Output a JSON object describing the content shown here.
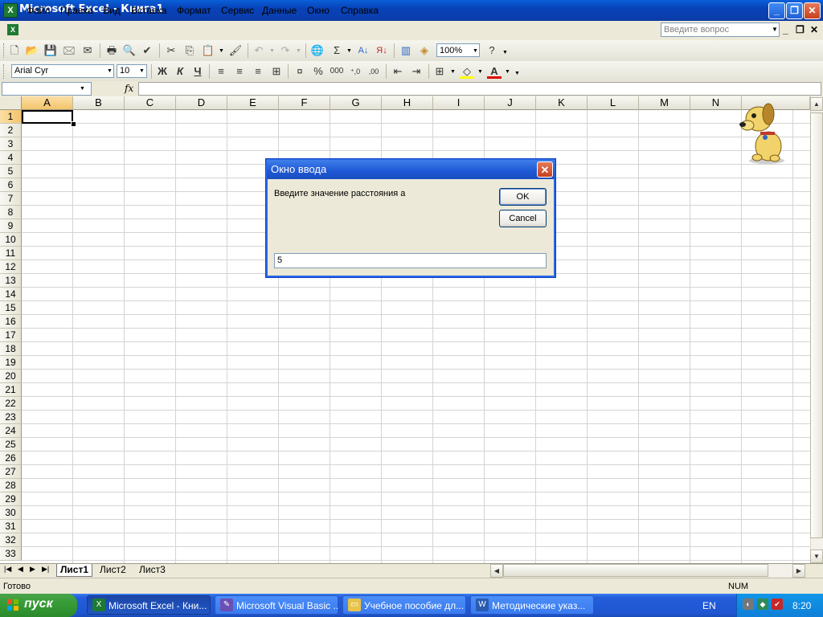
{
  "window": {
    "title": "Microsoft Excel - Книга1",
    "buttons": {
      "minimize": "_",
      "maximize": "❐",
      "close": "✕"
    }
  },
  "menu": {
    "items": [
      "Файл",
      "Правка",
      "Вид",
      "Вставка",
      "Формат",
      "Сервис",
      "Данные",
      "Окно",
      "Справка"
    ],
    "help_placeholder": "Введите вопрос"
  },
  "toolbar": {
    "zoom": "100%",
    "font_name": "Arial Cyr",
    "font_size": "10",
    "bold": "Ж",
    "italic": "К",
    "underline": "Ч"
  },
  "formula_bar": {
    "name_box": "",
    "fx": "fx",
    "content": ""
  },
  "sheet": {
    "columns": [
      "A",
      "B",
      "C",
      "D",
      "E",
      "F",
      "G",
      "H",
      "I",
      "J",
      "K",
      "L",
      "M",
      "N"
    ],
    "rows": [
      "1",
      "2",
      "3",
      "4",
      "5",
      "6",
      "7",
      "8",
      "9",
      "10",
      "11",
      "12",
      "13",
      "14",
      "15",
      "16",
      "17",
      "18",
      "19",
      "20",
      "21",
      "22",
      "23",
      "24",
      "25",
      "26",
      "27",
      "28",
      "29",
      "30",
      "31",
      "32",
      "33"
    ],
    "selected_column": "A",
    "selected_row": "1"
  },
  "tabs": {
    "sheets": [
      "Лист1",
      "Лист2",
      "Лист3"
    ],
    "active": "Лист1"
  },
  "status": {
    "text": "Готово",
    "num": "NUM"
  },
  "dialog": {
    "title": "Окно ввода",
    "prompt": "Введите значение расстояния а",
    "ok": "OK",
    "cancel": "Cancel",
    "input_value": "5"
  },
  "taskbar": {
    "start": "пуск",
    "tasks": [
      {
        "label": "Microsoft Excel - Кни...",
        "active": true
      },
      {
        "label": "Microsoft Visual Basic ...",
        "active": false
      },
      {
        "label": "Учебное пособие дл...",
        "active": false
      },
      {
        "label": "Методические указ...",
        "active": false
      }
    ],
    "lang": "EN",
    "clock": "8:20"
  }
}
